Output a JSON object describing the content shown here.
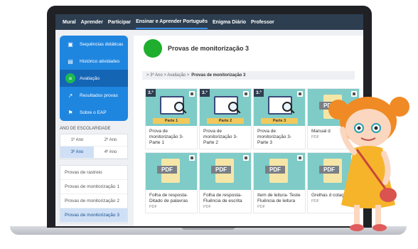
{
  "nav": [
    "Mural",
    "Aprender",
    "Participar",
    "Ensinar e Aprender Português",
    "Enigma Diário",
    "Professor"
  ],
  "nav_active": 3,
  "sidebar": {
    "items": [
      {
        "label": "Sequências didáticas",
        "icon": "slides-icon"
      },
      {
        "label": "Histórico atividades",
        "icon": "history-icon"
      },
      {
        "label": "Avaliação",
        "icon": "evaluation-icon"
      },
      {
        "label": "Resultados provas",
        "icon": "trend-icon"
      },
      {
        "label": "Sobre o EAP",
        "icon": "flag-icon"
      }
    ],
    "active": 2,
    "year_title": "ANO DE ESCOLARIDADE",
    "years": [
      "1º Ano",
      "2º Ano",
      "3º Ano",
      "4º Ano"
    ],
    "year_active": 2,
    "provas": [
      "Provas de rastreio",
      "Provas de monitorização 1",
      "Provas de monitorização 2",
      "Provas de monitorização 3"
    ],
    "prova_active": 3
  },
  "main": {
    "title": "Provas de monitorização 3",
    "breadcrumb_prefix": "> 3º Ano > Avaliação >",
    "breadcrumb_current": "Provas de monitorização 3"
  },
  "cards": [
    {
      "title": "Prova de monitorização 3- Parte 1",
      "badge": "3.º",
      "part": "Parte 1",
      "kind": "monitor"
    },
    {
      "title": "Prova de monitorização 3- Parte 2",
      "badge": "3.º",
      "part": "Parte 2",
      "kind": "monitor"
    },
    {
      "title": "Prova de monitorização 3- Parte 3",
      "badge": "3.º",
      "part": "Parte 3",
      "kind": "monitor"
    },
    {
      "title": "Manual d",
      "sub": "PDF",
      "kind": "pdf",
      "pdf": "PDF"
    },
    {
      "title": "Folha de resposta- Ditado de palavras",
      "sub": "PDF",
      "kind": "pdf",
      "pdf": "PDF"
    },
    {
      "title": "Folha de resposta- Fluência de escrita",
      "sub": "PDF",
      "kind": "pdf",
      "pdf": "PDF"
    },
    {
      "title": "Item de leitura- Teste Fluência de leitura",
      "sub": "PDF",
      "kind": "pdf",
      "pdf": "PDF"
    },
    {
      "title": "Grelhas d cotação",
      "sub": "PDF",
      "kind": "pdf",
      "pdf": "PDF"
    }
  ],
  "colors": {
    "nav": "#2d3e50",
    "accent": "#1f86e0",
    "thumb": "#7fcbc7",
    "status_dot": "#1fae2e"
  }
}
